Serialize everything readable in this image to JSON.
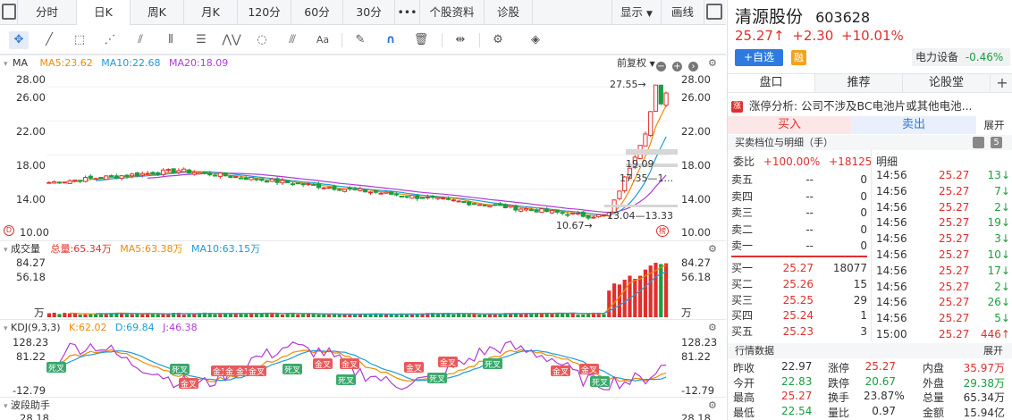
{
  "tabs": [
    "分时",
    "日K",
    "周K",
    "月K",
    "120分",
    "60分",
    "30分",
    "•••",
    "个股资料",
    "诊股"
  ],
  "top_right": {
    "display": "显示",
    "draw": "画线"
  },
  "ma_panel": {
    "label": "MA",
    "ma5": "MA5:23.62",
    "ma10": "MA10:22.68",
    "ma20": "MA20:18.09",
    "fuquan": "前复权"
  },
  "price_axis": [
    "28.00",
    "26.00",
    "22.00",
    "18.00",
    "14.00",
    "10.00"
  ],
  "price_annotations": {
    "high": "27.55→",
    "low": "10.67→",
    "r1": "19.09",
    "r2": "17.35—1...",
    "r3": "13.04—13.33",
    "bang": "榜"
  },
  "vol_panel": {
    "label": "成交量",
    "total": "总量:65.34万",
    "ma5": "MA5:63.38万",
    "ma10": "MA10:63.15万",
    "axis": [
      "84.27",
      "56.18",
      "万"
    ]
  },
  "kdj_panel": {
    "label": "KDJ(9,3,3)",
    "k": "K:62.02",
    "d": "D:69.84",
    "j": "J:46.38",
    "axis": [
      "128.23",
      "81.22",
      "-12.79"
    ],
    "gold": "金叉",
    "dead": "死叉"
  },
  "wave_panel": {
    "label": "波段助手",
    "axis": "28.18"
  },
  "colors": {
    "up": "#e0302d",
    "down": "#1a9e3f",
    "ma5": "#f08a00",
    "ma10": "#1e9bd6",
    "ma20": "#b23ad6"
  },
  "stock": {
    "name": "清源股份",
    "code": "603628",
    "price": "25.27↑",
    "change": "+2.30",
    "pct": "+10.01%",
    "watch": "+自选",
    "rong": "融",
    "sector": "电力设备",
    "sector_pct": "-0.46%"
  },
  "rtabs": [
    "盘口",
    "推荐",
    "论股堂"
  ],
  "limit_analysis": "涨停分析: 公司不涉及BC电池片或其他电池...",
  "trade": {
    "buy": "买入",
    "sell": "卖出",
    "expand": "展开"
  },
  "levels_title": "买卖档位与明细（手）",
  "levels_count": "5",
  "weibi": {
    "label": "委比",
    "pct": "+100.00%",
    "diff": "+18125"
  },
  "detail_label": "明细",
  "asks": [
    [
      "卖五",
      "--",
      "0"
    ],
    [
      "卖四",
      "--",
      "0"
    ],
    [
      "卖三",
      "--",
      "0"
    ],
    [
      "卖二",
      "--",
      "0"
    ],
    [
      "卖一",
      "--",
      "0"
    ]
  ],
  "bids": [
    [
      "买一",
      "25.27",
      "18077"
    ],
    [
      "买二",
      "25.26",
      "15"
    ],
    [
      "买三",
      "25.25",
      "29"
    ],
    [
      "买四",
      "25.24",
      "1"
    ],
    [
      "买五",
      "25.23",
      "3"
    ]
  ],
  "ticks": [
    [
      "14:56",
      "25.27",
      "13↓"
    ],
    [
      "14:56",
      "25.27",
      "7↓"
    ],
    [
      "14:56",
      "25.27",
      "2↓"
    ],
    [
      "14:56",
      "25.27",
      "19↓"
    ],
    [
      "14:56",
      "25.27",
      "3↓"
    ],
    [
      "14:56",
      "25.27",
      "10↓"
    ],
    [
      "14:56",
      "25.27",
      "17↓"
    ],
    [
      "14:56",
      "25.27",
      "2↓"
    ],
    [
      "14:56",
      "25.27",
      "26↓"
    ],
    [
      "14:56",
      "25.27",
      "5↓"
    ],
    [
      "15:00",
      "25.27",
      "446↑"
    ]
  ],
  "quote_title": "行情数据",
  "quote_expand": "展开",
  "quotes": [
    [
      "昨收",
      "22.97",
      "涨停",
      "25.27",
      "内盘",
      "35.97万"
    ],
    [
      "今开",
      "22.83",
      "跌停",
      "20.67",
      "外盘",
      "29.38万"
    ],
    [
      "最高",
      "25.27",
      "换手",
      "23.87%",
      "总量",
      "65.34万"
    ],
    [
      "最低",
      "22.54",
      "量比",
      "0.97",
      "金额",
      "15.94亿"
    ]
  ]
}
